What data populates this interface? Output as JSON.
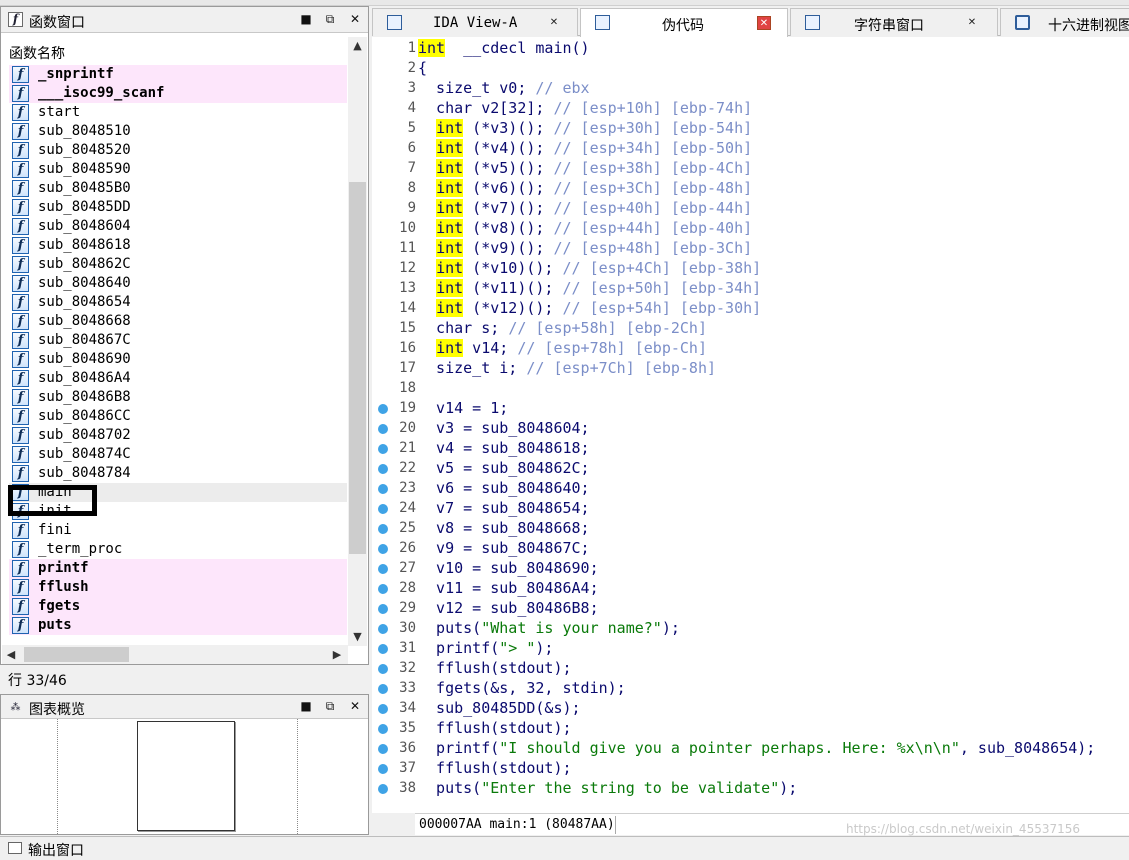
{
  "function_window": {
    "title": "函数窗口",
    "column_header": "函数名称",
    "functions": [
      {
        "name": "_snprintf",
        "lib": true
      },
      {
        "name": "___isoc99_scanf",
        "lib": true
      },
      {
        "name": "start",
        "lib": false
      },
      {
        "name": "sub_8048510",
        "lib": false
      },
      {
        "name": "sub_8048520",
        "lib": false
      },
      {
        "name": "sub_8048590",
        "lib": false
      },
      {
        "name": "sub_80485B0",
        "lib": false
      },
      {
        "name": "sub_80485DD",
        "lib": false
      },
      {
        "name": "sub_8048604",
        "lib": false
      },
      {
        "name": "sub_8048618",
        "lib": false
      },
      {
        "name": "sub_804862C",
        "lib": false
      },
      {
        "name": "sub_8048640",
        "lib": false
      },
      {
        "name": "sub_8048654",
        "lib": false
      },
      {
        "name": "sub_8048668",
        "lib": false
      },
      {
        "name": "sub_804867C",
        "lib": false
      },
      {
        "name": "sub_8048690",
        "lib": false
      },
      {
        "name": "sub_80486A4",
        "lib": false
      },
      {
        "name": "sub_80486B8",
        "lib": false
      },
      {
        "name": "sub_80486CC",
        "lib": false
      },
      {
        "name": "sub_8048702",
        "lib": false
      },
      {
        "name": "sub_804874C",
        "lib": false
      },
      {
        "name": "sub_8048784",
        "lib": false
      },
      {
        "name": "main",
        "lib": false,
        "selected": true
      },
      {
        "name": "init",
        "lib": false
      },
      {
        "name": "fini",
        "lib": false
      },
      {
        "name": "_term_proc",
        "lib": false
      },
      {
        "name": "printf",
        "lib": true
      },
      {
        "name": "fflush",
        "lib": true
      },
      {
        "name": "fgets",
        "lib": true
      },
      {
        "name": "puts",
        "lib": true
      }
    ],
    "row_count": "行 33/46"
  },
  "graph_overview": {
    "title": "图表概览"
  },
  "output_window": {
    "title": "输出窗口"
  },
  "tabs": [
    {
      "label": "IDA View-A",
      "active": false,
      "icon": "ida-view-icon"
    },
    {
      "label": "伪代码",
      "active": true,
      "icon": "pseudocode-icon"
    },
    {
      "label": "字符串窗口",
      "active": false,
      "icon": "strings-icon"
    },
    {
      "label": "十六进制视图",
      "active": false,
      "icon": "hex-view-icon"
    }
  ],
  "pseudocode": {
    "lines": [
      {
        "n": "1",
        "bp": false,
        "parts": [
          [
            "kw",
            "int"
          ],
          [
            "",
            "  __cdecl main()"
          ]
        ]
      },
      {
        "n": "2",
        "bp": false,
        "parts": [
          [
            "",
            "{"
          ]
        ]
      },
      {
        "n": "3",
        "bp": false,
        "parts": [
          [
            "",
            "  size_t v0; "
          ],
          [
            "cm",
            "// ebx"
          ]
        ]
      },
      {
        "n": "4",
        "bp": false,
        "parts": [
          [
            "",
            "  char v2[32]; "
          ],
          [
            "cm",
            "// [esp+10h] [ebp-74h]"
          ]
        ]
      },
      {
        "n": "5",
        "bp": false,
        "parts": [
          [
            "",
            "  "
          ],
          [
            "kw",
            "int"
          ],
          [
            "",
            " (*v3)(); "
          ],
          [
            "cm",
            "// [esp+30h] [ebp-54h]"
          ]
        ]
      },
      {
        "n": "6",
        "bp": false,
        "parts": [
          [
            "",
            "  "
          ],
          [
            "kw",
            "int"
          ],
          [
            "",
            " (*v4)(); "
          ],
          [
            "cm",
            "// [esp+34h] [ebp-50h]"
          ]
        ]
      },
      {
        "n": "7",
        "bp": false,
        "parts": [
          [
            "",
            "  "
          ],
          [
            "kw",
            "int"
          ],
          [
            "",
            " (*v5)(); "
          ],
          [
            "cm",
            "// [esp+38h] [ebp-4Ch]"
          ]
        ]
      },
      {
        "n": "8",
        "bp": false,
        "parts": [
          [
            "",
            "  "
          ],
          [
            "kw",
            "int"
          ],
          [
            "",
            " (*v6)(); "
          ],
          [
            "cm",
            "// [esp+3Ch] [ebp-48h]"
          ]
        ]
      },
      {
        "n": "9",
        "bp": false,
        "parts": [
          [
            "",
            "  "
          ],
          [
            "kw",
            "int"
          ],
          [
            "",
            " (*v7)(); "
          ],
          [
            "cm",
            "// [esp+40h] [ebp-44h]"
          ]
        ]
      },
      {
        "n": "10",
        "bp": false,
        "parts": [
          [
            "",
            "  "
          ],
          [
            "kw",
            "int"
          ],
          [
            "",
            " (*v8)(); "
          ],
          [
            "cm",
            "// [esp+44h] [ebp-40h]"
          ]
        ]
      },
      {
        "n": "11",
        "bp": false,
        "parts": [
          [
            "",
            "  "
          ],
          [
            "kw",
            "int"
          ],
          [
            "",
            " (*v9)(); "
          ],
          [
            "cm",
            "// [esp+48h] [ebp-3Ch]"
          ]
        ]
      },
      {
        "n": "12",
        "bp": false,
        "parts": [
          [
            "",
            "  "
          ],
          [
            "kw",
            "int"
          ],
          [
            "",
            " (*v10)(); "
          ],
          [
            "cm",
            "// [esp+4Ch] [ebp-38h]"
          ]
        ]
      },
      {
        "n": "13",
        "bp": false,
        "parts": [
          [
            "",
            "  "
          ],
          [
            "kw",
            "int"
          ],
          [
            "",
            " (*v11)(); "
          ],
          [
            "cm",
            "// [esp+50h] [ebp-34h]"
          ]
        ]
      },
      {
        "n": "14",
        "bp": false,
        "parts": [
          [
            "",
            "  "
          ],
          [
            "kw",
            "int"
          ],
          [
            "",
            " (*v12)(); "
          ],
          [
            "cm",
            "// [esp+54h] [ebp-30h]"
          ]
        ]
      },
      {
        "n": "15",
        "bp": false,
        "parts": [
          [
            "",
            "  char s; "
          ],
          [
            "cm",
            "// [esp+58h] [ebp-2Ch]"
          ]
        ]
      },
      {
        "n": "16",
        "bp": false,
        "parts": [
          [
            "",
            "  "
          ],
          [
            "kw",
            "int"
          ],
          [
            "",
            " v14; "
          ],
          [
            "cm",
            "// [esp+78h] [ebp-Ch]"
          ]
        ]
      },
      {
        "n": "17",
        "bp": false,
        "parts": [
          [
            "",
            "  size_t i; "
          ],
          [
            "cm",
            "// [esp+7Ch] [ebp-8h]"
          ]
        ]
      },
      {
        "n": "18",
        "bp": false,
        "parts": [
          [
            "",
            ""
          ]
        ]
      },
      {
        "n": "19",
        "bp": true,
        "parts": [
          [
            "",
            "  v14 = 1;"
          ]
        ]
      },
      {
        "n": "20",
        "bp": true,
        "parts": [
          [
            "",
            "  v3 = sub_8048604;"
          ]
        ]
      },
      {
        "n": "21",
        "bp": true,
        "parts": [
          [
            "",
            "  v4 = sub_8048618;"
          ]
        ]
      },
      {
        "n": "22",
        "bp": true,
        "parts": [
          [
            "",
            "  v5 = sub_804862C;"
          ]
        ]
      },
      {
        "n": "23",
        "bp": true,
        "parts": [
          [
            "",
            "  v6 = sub_8048640;"
          ]
        ]
      },
      {
        "n": "24",
        "bp": true,
        "parts": [
          [
            "",
            "  v7 = sub_8048654;"
          ]
        ]
      },
      {
        "n": "25",
        "bp": true,
        "parts": [
          [
            "",
            "  v8 = sub_8048668;"
          ]
        ]
      },
      {
        "n": "26",
        "bp": true,
        "parts": [
          [
            "",
            "  v9 = sub_804867C;"
          ]
        ]
      },
      {
        "n": "27",
        "bp": true,
        "parts": [
          [
            "",
            "  v10 = sub_8048690;"
          ]
        ]
      },
      {
        "n": "28",
        "bp": true,
        "parts": [
          [
            "",
            "  v11 = sub_80486A4;"
          ]
        ]
      },
      {
        "n": "29",
        "bp": true,
        "parts": [
          [
            "",
            "  v12 = sub_80486B8;"
          ]
        ]
      },
      {
        "n": "30",
        "bp": true,
        "parts": [
          [
            "",
            "  puts("
          ],
          [
            "st",
            "\"What is your name?\""
          ],
          [
            "",
            ");"
          ]
        ]
      },
      {
        "n": "31",
        "bp": true,
        "parts": [
          [
            "",
            "  printf("
          ],
          [
            "st",
            "\"> \""
          ],
          [
            "",
            ");"
          ]
        ]
      },
      {
        "n": "32",
        "bp": true,
        "parts": [
          [
            "",
            "  fflush(stdout);"
          ]
        ]
      },
      {
        "n": "33",
        "bp": true,
        "parts": [
          [
            "",
            "  fgets(&s, 32, stdin);"
          ]
        ]
      },
      {
        "n": "34",
        "bp": true,
        "parts": [
          [
            "",
            "  sub_80485DD(&s);"
          ]
        ]
      },
      {
        "n": "35",
        "bp": true,
        "parts": [
          [
            "",
            "  fflush(stdout);"
          ]
        ]
      },
      {
        "n": "36",
        "bp": true,
        "parts": [
          [
            "",
            "  printf("
          ],
          [
            "st",
            "\"I should give you a pointer perhaps. Here: %x\\n\\n\""
          ],
          [
            "",
            ", sub_8048654);"
          ]
        ]
      },
      {
        "n": "37",
        "bp": true,
        "parts": [
          [
            "",
            "  fflush(stdout);"
          ]
        ]
      },
      {
        "n": "38",
        "bp": true,
        "parts": [
          [
            "",
            "  puts("
          ],
          [
            "st",
            "\"Enter the string to be validate\""
          ],
          [
            "",
            ");"
          ]
        ]
      }
    ]
  },
  "status": {
    "location": "000007AA main:1 (80487AA)"
  },
  "watermark": "https://blog.csdn.net/weixin_45537156",
  "colors": {
    "keyword_highlight": "#ffff00",
    "comment": "#7b8ec8",
    "string": "#0a7a0a",
    "code": "#0a0a6e",
    "lib_function_bg": "#fde6fb",
    "breakpoint_dot": "#3fa3e6",
    "active_tab_close": "#e04343"
  }
}
